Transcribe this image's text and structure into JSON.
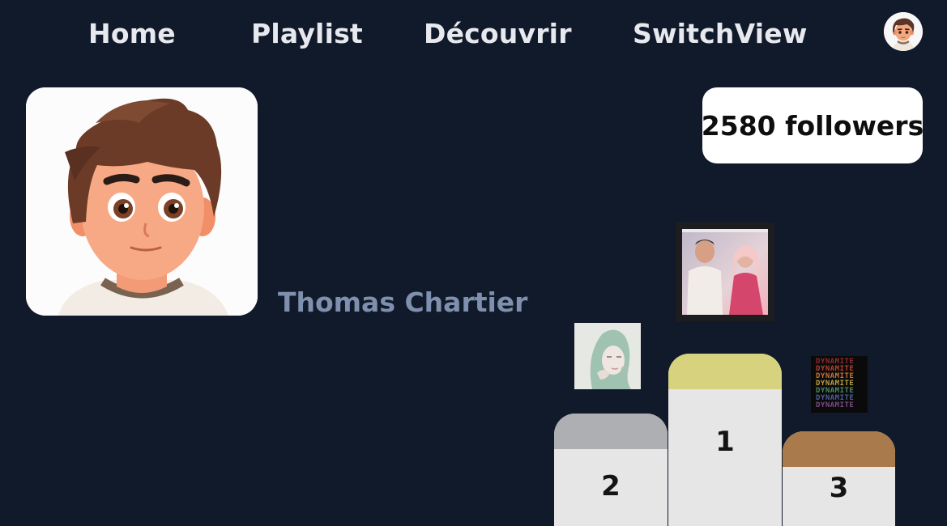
{
  "nav": {
    "items": [
      {
        "label": "Home"
      },
      {
        "label": "Playlist"
      },
      {
        "label": "Découvrir"
      },
      {
        "label": "SwitchView"
      }
    ]
  },
  "profile": {
    "name": "Thomas Chartier",
    "followers": "2580 followers"
  },
  "podium": {
    "ranks": [
      {
        "rank": "1",
        "color": "#d7d27e"
      },
      {
        "rank": "2",
        "color": "#adafb3"
      },
      {
        "rank": "3",
        "color": "#a87a4c"
      }
    ]
  },
  "album_3_text": "DYNAMITE",
  "colors": {
    "background": "#111a2a",
    "nav_text": "#e7e9ee",
    "name_text": "#7e90ad",
    "badge_bg": "#ffffff"
  }
}
